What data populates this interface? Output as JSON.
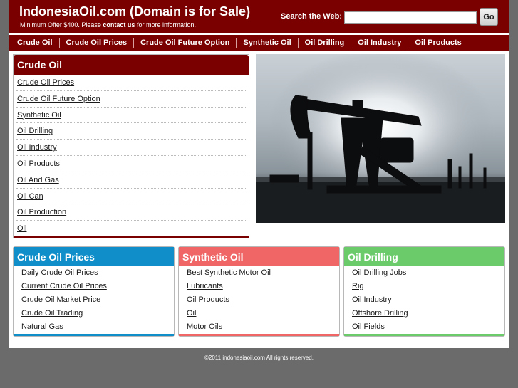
{
  "header": {
    "title": "IndonesiaOil.com (Domain is for Sale)",
    "offer_prefix": "Minimum Offer $400. Please",
    "offer_link": "contact us",
    "offer_suffix": "for more information.",
    "brand_color": "#7a0000"
  },
  "search": {
    "label": "Search the Web:",
    "value": "",
    "button_label": "Go"
  },
  "nav": {
    "items": [
      "Crude Oil",
      "Crude Oil Prices",
      "Crude Oil Future Option",
      "Synthetic Oil",
      "Oil Drilling",
      "Oil Industry",
      "Oil Products"
    ]
  },
  "main_box": {
    "title": "Crude Oil",
    "links": [
      "Crude Oil Prices",
      "Crude Oil Future Option",
      "Synthetic Oil",
      "Oil Drilling",
      "Oil Industry",
      "Oil Products",
      "Oil And Gas",
      "Oil Can",
      "Oil Production",
      "Oil"
    ]
  },
  "photo": {
    "icon": "oil-pumpjack-photo"
  },
  "boxes": [
    {
      "title": "Crude Oil Prices",
      "color": "#0f8ec9",
      "links": [
        "Daily Crude Oil Prices",
        "Current Crude Oil Prices",
        "Crude Oil Market Price",
        "Crude Oil Trading",
        "Natural Gas"
      ]
    },
    {
      "title": "Synthetic Oil",
      "color": "#f06565",
      "links": [
        "Best Synthetic Motor Oil",
        "Lubricants",
        "Oil Products",
        "Oil",
        "Motor Oils"
      ]
    },
    {
      "title": "Oil Drilling",
      "color": "#6bcb6b",
      "links": [
        "Oil Drilling Jobs",
        "Rig",
        "Oil Industry",
        "Offshore Drilling",
        "Oil Fields"
      ]
    }
  ],
  "footer": {
    "copyright": "©2011 indonesiaoil.com All rights reserved."
  }
}
